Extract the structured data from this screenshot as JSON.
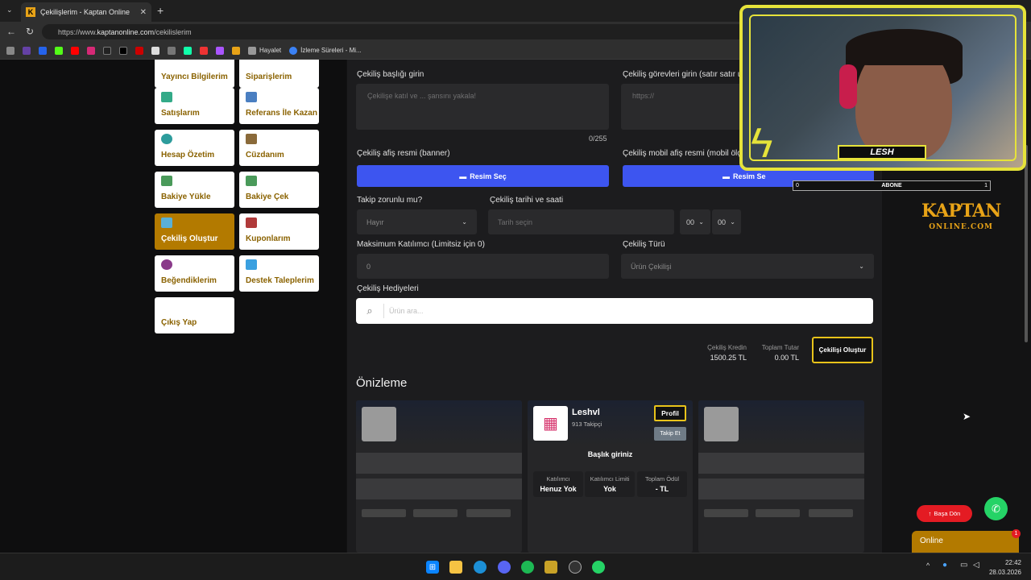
{
  "browser": {
    "tab_title": "Çekilişlerim - Kaptan Online",
    "url_prefix": "https://www.",
    "url_domain": "kaptanonline.com",
    "url_path": "/cekilislerim",
    "bookmarks": [
      {
        "label": "Hayalet"
      },
      {
        "label": "İzleme Süreleri - Mi..."
      }
    ]
  },
  "sidebar": {
    "items": [
      {
        "label": "Yayıncı Bilgilerim",
        "icon": "user-icon"
      },
      {
        "label": "Siparişlerim",
        "icon": "order-icon"
      },
      {
        "label": "Satışlarım",
        "icon": "cart-icon"
      },
      {
        "label": "Referans İle Kazan",
        "icon": "referral-icon"
      },
      {
        "label": "Hesap Özetim",
        "icon": "chart-icon"
      },
      {
        "label": "Cüzdanım",
        "icon": "wallet-icon"
      },
      {
        "label": "Bakiye Yükle",
        "icon": "deposit-icon"
      },
      {
        "label": "Bakiye Çek",
        "icon": "withdraw-icon"
      },
      {
        "label": "Çekiliş Oluştur",
        "icon": "giveaway-icon"
      },
      {
        "label": "Kuponlarım",
        "icon": "coupon-icon"
      },
      {
        "label": "Beğendiklerim",
        "icon": "like-icon"
      },
      {
        "label": "Destek Taleplerim",
        "icon": "support-icon"
      },
      {
        "label": "Çıkış Yap",
        "icon": ""
      }
    ]
  },
  "form": {
    "title_label": "Çekiliş başlığı girin",
    "title_placeholder": "Çekilişe katıl ve ... şansını yakala!",
    "title_counter": "0/255",
    "tasks_label": "Çekiliş görevleri girin (satır satır ur",
    "tasks_placeholder": "https://",
    "banner_label": "Çekiliş afiş resmi (banner)",
    "banner_button": "Resim Seç",
    "mobile_label": "Çekiliş mobil afiş resmi (mobil ölçe",
    "mobile_button": "Resim Se",
    "follow_label": "Takip zorunlu mu?",
    "follow_value": "Hayır",
    "date_label": "Çekiliş tarihi ve saati",
    "date_placeholder": "Tarih seçin",
    "hour_value": "00",
    "minute_value": "00",
    "max_label": "Maksimum Katılımcı (Limitsiz için 0)",
    "max_value": "0",
    "type_label": "Çekiliş Türü",
    "type_value": "Ürün Çekilişi",
    "gifts_label": "Çekiliş Hediyeleri",
    "search_placeholder": "Ürün ara..."
  },
  "summary": {
    "credit_label": "Çekiliş Kredin",
    "credit_value": "1500.25 TL",
    "total_label": "Toplam Tutar",
    "total_value": "0.00 TL",
    "create_button": "Çekilişi Oluştur"
  },
  "preview": {
    "title": "Önizleme",
    "streamer_name": "Leshvl",
    "followers": "913 Takipçi",
    "profile_button": "Profil",
    "follow_button": "Takip Et",
    "card_title": "Başlık giriniz",
    "stats": [
      {
        "label": "Katılımcı",
        "value": "Henuz Yok"
      },
      {
        "label": "Katılımcı Limiti",
        "value": "Yok"
      },
      {
        "label": "Toplam Ödül",
        "value": "- TL"
      }
    ]
  },
  "overlay": {
    "name": "LESH",
    "abone_left": "0",
    "abone_mid": "ABONE",
    "abone_right": "1"
  },
  "logo": {
    "main": "KAPTAN",
    "sub": "ONLINE.COM"
  },
  "widgets": {
    "back_to_top": "Başa Dön",
    "online": "Online",
    "badge": "1"
  },
  "taskbar": {
    "time": "22:42",
    "date": "28.03.2026"
  },
  "colors": {
    "accent": "#b37a00",
    "button_blue": "#3d55f0",
    "overlay_yellow": "#e6e33a"
  }
}
